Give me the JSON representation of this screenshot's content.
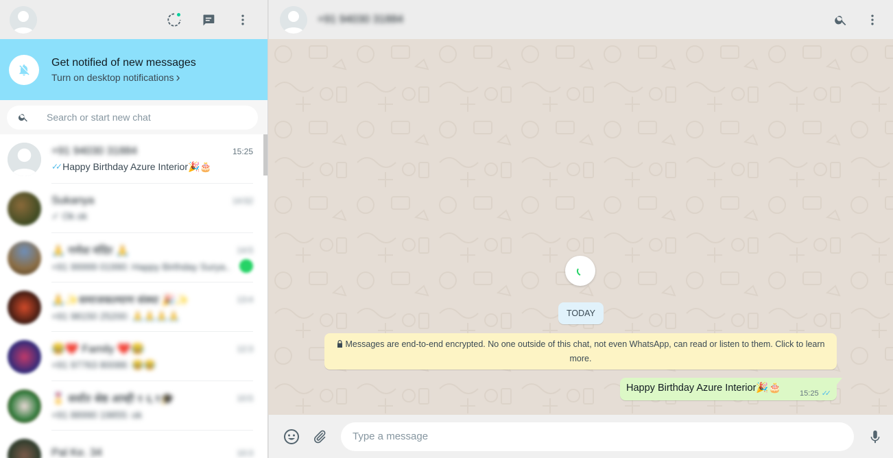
{
  "sidebar": {
    "header": {
      "icons": [
        "status-icon",
        "new-chat-icon",
        "menu-icon"
      ]
    },
    "notification": {
      "title": "Get notified of new messages",
      "link": "Turn on desktop notifications",
      "chevron": "›"
    },
    "search": {
      "placeholder": "Search or start new chat"
    },
    "chats": [
      {
        "name": "+91 94030 31884",
        "time": "15:25",
        "ticks": "✓✓",
        "preview": "Happy Birthday Azure Interior🎉🎂",
        "blurred": false
      },
      {
        "name": "Sukanya",
        "time": "14:52",
        "ticks": "",
        "preview": "✓ Ok ok",
        "blurred": true
      },
      {
        "name": "🙏 गणेश मंदिर 🙏",
        "time": "14:5",
        "ticks": "",
        "preview": "+91 99999 01990: Happy Birthday Surya...",
        "blurred": true
      },
      {
        "name": "🙏✨समाजकल्याण संस्था 🎉✨",
        "time": "13:4",
        "ticks": "",
        "preview": "+91 98150 25200: 🙏🙏🙏🙏",
        "blurred": true
      },
      {
        "name": "😂❤️ Family ❤️😂",
        "time": "12:3",
        "ticks": "",
        "preview": "+91 97763 80088: 😂😂",
        "blurred": true
      },
      {
        "name": "🎖️ सर्वांत श्रेष्ठ आम्ही १ ६.९🎓",
        "time": "10:5",
        "ticks": "",
        "preview": "+91 88990 19855: ok",
        "blurred": true
      },
      {
        "name": "Pal Ke. 34",
        "time": "10:3",
        "ticks": "",
        "preview": "",
        "blurred": true
      }
    ]
  },
  "conversation": {
    "header": {
      "title": "+91 94030 31884"
    },
    "date_chip": "TODAY",
    "encryption_notice": "Messages are end-to-end encrypted. No one outside of this chat, not even WhatsApp, can read or listen to them. Click to learn more.",
    "messages": [
      {
        "text": "Happy Birthday Azure Interior🎉🎂",
        "time": "15:25",
        "ticks": "✓✓",
        "direction": "out"
      }
    ],
    "composer": {
      "placeholder": "Type a message"
    }
  },
  "colors": {
    "notification_bg": "#8ce0fb",
    "chat_bg": "#e5ddd5",
    "outgoing_bubble": "#dcf8c6",
    "encryption_bg": "#fdf4c5",
    "date_chip_bg": "#e1f2fb",
    "read_ticks": "#53bdeb",
    "unread_badge": "#25d366",
    "status_dot": "#06cf9c"
  }
}
